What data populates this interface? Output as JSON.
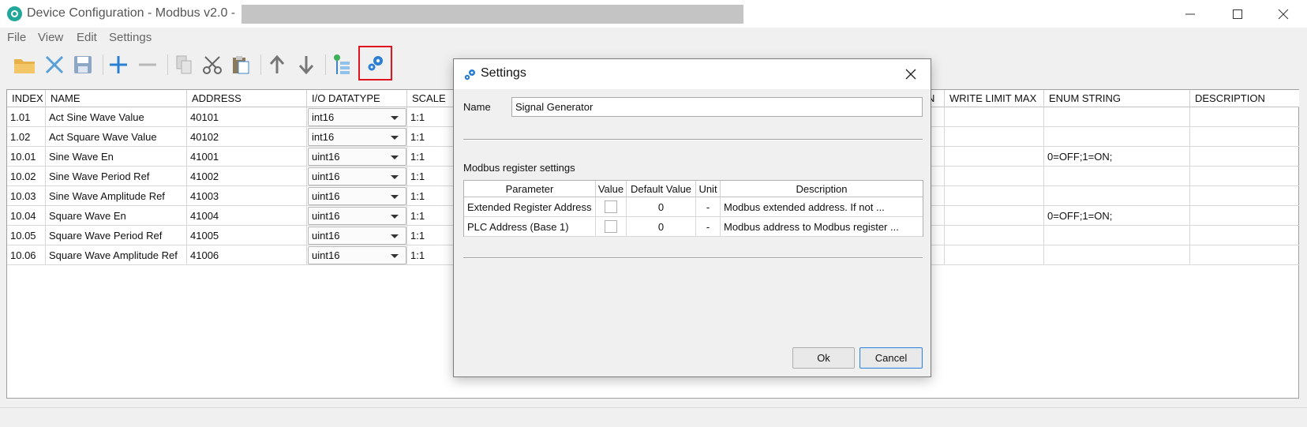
{
  "window": {
    "title": "Device Configuration - Modbus v2.0 -",
    "minimize": "─",
    "maximize": "☐",
    "close": "✕"
  },
  "menu": [
    "File",
    "View",
    "Edit",
    "Settings"
  ],
  "toolbar": {
    "icons": [
      "open-folder-icon",
      "close-x-icon",
      "save-icon",
      "add-icon",
      "remove-icon",
      "copy-icon",
      "cut-icon",
      "paste-icon",
      "move-up-icon",
      "move-down-icon",
      "add-tree-icon",
      "settings-gears-icon"
    ],
    "accent": "#1e78d2",
    "highlight_color": "#e0141e"
  },
  "table": {
    "headers": [
      "INDEX",
      "NAME",
      "ADDRESS",
      "I/O DATATYPE",
      "SCALE",
      "N",
      "WRITE LIMIT MAX",
      "ENUM STRING",
      "DESCRIPTION"
    ],
    "rows": [
      {
        "index": "1.01",
        "name": "Act Sine Wave Value",
        "address": "40101",
        "datatype": "int16",
        "scale": "1:1",
        "write_limit_max": "",
        "enum": "",
        "description": ""
      },
      {
        "index": "1.02",
        "name": "Act Square Wave Value",
        "address": "40102",
        "datatype": "int16",
        "scale": "1:1",
        "write_limit_max": "",
        "enum": "",
        "description": ""
      },
      {
        "index": "10.01",
        "name": "Sine Wave En",
        "address": "41001",
        "datatype": "uint16",
        "scale": "1:1",
        "write_limit_max": "",
        "enum": "0=OFF;1=ON;",
        "description": ""
      },
      {
        "index": "10.02",
        "name": "Sine Wave Period Ref",
        "address": "41002",
        "datatype": "uint16",
        "scale": "1:1",
        "write_limit_max": "",
        "enum": "",
        "description": ""
      },
      {
        "index": "10.03",
        "name": "Sine Wave Amplitude Ref",
        "address": "41003",
        "datatype": "uint16",
        "scale": "1:1",
        "write_limit_max": "",
        "enum": "",
        "description": ""
      },
      {
        "index": "10.04",
        "name": "Square Wave En",
        "address": "41004",
        "datatype": "uint16",
        "scale": "1:1",
        "write_limit_max": "",
        "enum": "0=OFF;1=ON;",
        "description": ""
      },
      {
        "index": "10.05",
        "name": "Square Wave Period Ref",
        "address": "41005",
        "datatype": "uint16",
        "scale": "1:1",
        "write_limit_max": "",
        "enum": "",
        "description": ""
      },
      {
        "index": "10.06",
        "name": "Square Wave Amplitude Ref",
        "address": "41006",
        "datatype": "uint16",
        "scale": "1:1",
        "write_limit_max": "",
        "enum": "",
        "description": ""
      }
    ]
  },
  "dialog": {
    "title": "Settings",
    "name_label": "Name",
    "name_value": "Signal Generator",
    "section_label": "Modbus register settings",
    "reg_headers": [
      "Parameter",
      "Value",
      "Default Value",
      "Unit",
      "Description"
    ],
    "reg_rows": [
      {
        "parameter": "Extended Register Address",
        "value_checked": false,
        "default": "0",
        "unit": "-",
        "description": "Modbus extended address. If not ..."
      },
      {
        "parameter": "PLC Address (Base 1)",
        "value_checked": false,
        "default": "0",
        "unit": "-",
        "description": "Modbus address to Modbus register ..."
      }
    ],
    "ok_label": "Ok",
    "cancel_label": "Cancel"
  }
}
